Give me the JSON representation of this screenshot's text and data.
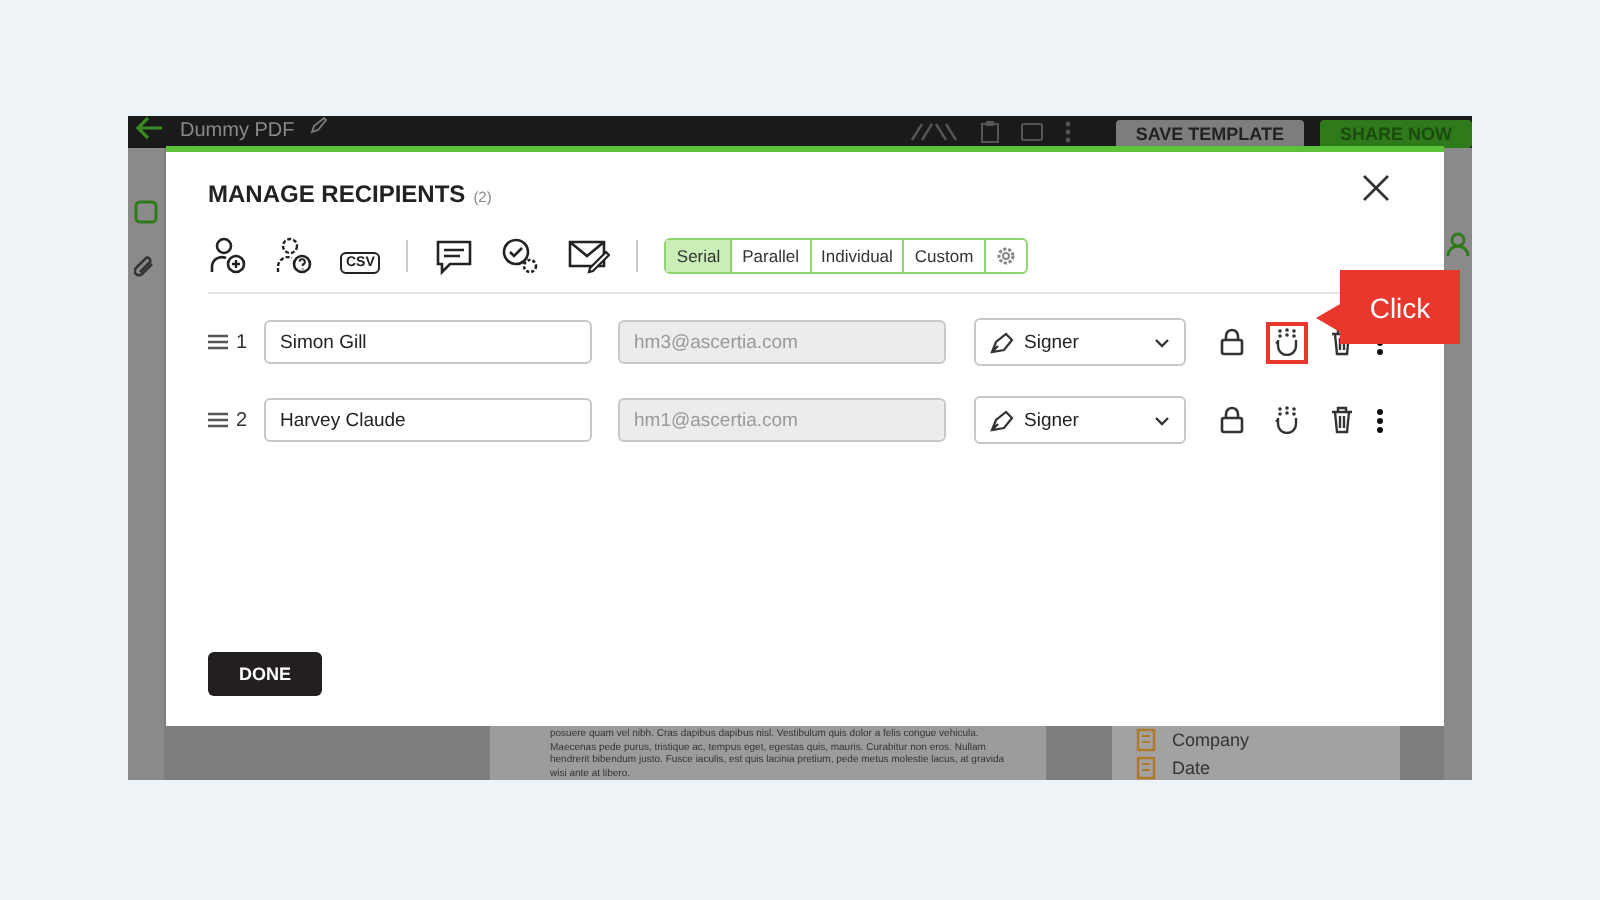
{
  "app": {
    "document_title": "Dummy PDF",
    "header_buttons": [
      {
        "label": "SAVE TEMPLATE",
        "kind": "secondary"
      },
      {
        "label": "SHARE NOW",
        "kind": "primary"
      }
    ],
    "document_lines": [
      "posuere quam vel nibh. Cras dapibus dapibus nisl. Vestibulum quis dolor a felis congue vehicula.",
      "Maecenas pede purus, tristique ac, tempus eget, egestas quis, mauris. Curabitur non eros. Nullam",
      "hendrerit bibendum justo. Fusce iaculis, est quis lacinia pretium, pede metus molestie lacus, at gravida",
      "wisi ante at libero."
    ],
    "fields": [
      "Company",
      "Date"
    ]
  },
  "dialog": {
    "title": "MANAGE RECIPIENTS",
    "count": "(2)",
    "csv_icon_text": "CSV",
    "modes": [
      {
        "label": "Serial",
        "selected": true
      },
      {
        "label": "Parallel",
        "selected": false
      },
      {
        "label": "Individual",
        "selected": false
      },
      {
        "label": "Custom",
        "selected": false
      }
    ],
    "recipients": [
      {
        "number": "1",
        "name": "Simon Gill",
        "email": "hm3@ascertia.com",
        "role": "Signer",
        "highlighted": true
      },
      {
        "number": "2",
        "name": "Harvey Claude",
        "email": "hm1@ascertia.com",
        "role": "Signer",
        "highlighted": false
      }
    ],
    "done_button": "DONE"
  },
  "callout": {
    "text": "Click"
  }
}
